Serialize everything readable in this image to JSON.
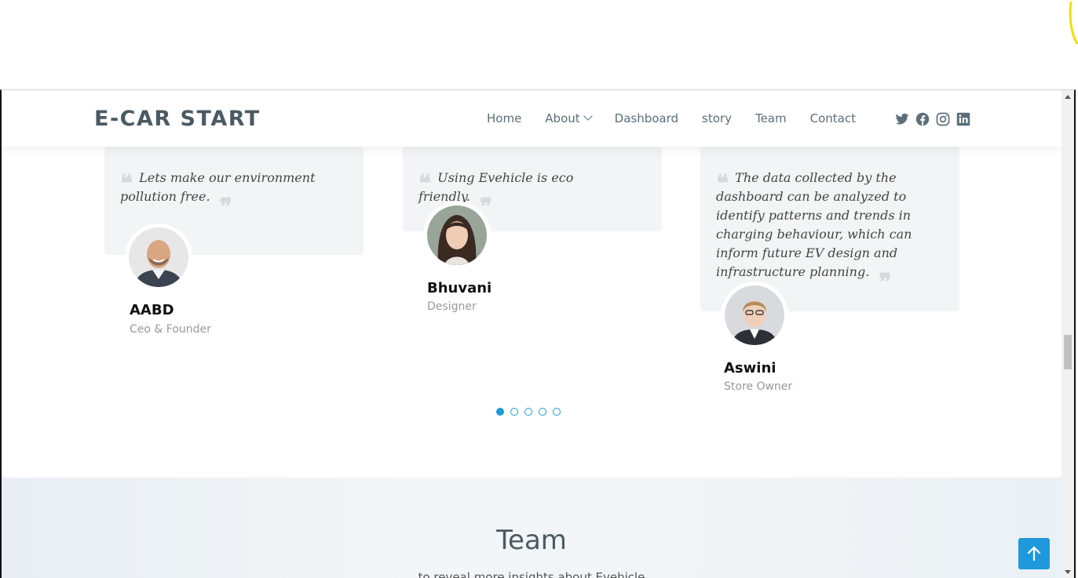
{
  "header": {
    "logo": "E-CAR START",
    "nav": [
      {
        "label": "Home",
        "name": "nav-home"
      },
      {
        "label": "About",
        "name": "nav-about",
        "dropdown": true
      },
      {
        "label": "Dashboard",
        "name": "nav-dashboard"
      },
      {
        "label": "story",
        "name": "nav-story"
      },
      {
        "label": "Team",
        "name": "nav-team"
      },
      {
        "label": "Contact",
        "name": "nav-contact"
      }
    ],
    "social_icons": [
      "twitter-icon",
      "facebook-icon",
      "instagram-icon",
      "linkedin-icon"
    ]
  },
  "testimonials": [
    {
      "quote": "Lets make our environment pollution free.",
      "name": "AABD",
      "role": "Ceo & Founder"
    },
    {
      "quote": "Using Evehicle is eco friendly.",
      "name": "Bhuvani",
      "role": "Designer"
    },
    {
      "quote": "The data collected by the dashboard can be analyzed to identify patterns and trends in charging behaviour, which can inform future EV design and infrastructure planning.",
      "name": "Aswini",
      "role": "Store Owner"
    }
  ],
  "pagination": {
    "count": 5,
    "active": 0
  },
  "team": {
    "title": "Team",
    "subtitle": "to reveal more insights about Evehicle"
  },
  "colors": {
    "accent": "#1e9adc",
    "logo": "#4b5a62",
    "nav": "#5b6f7a",
    "quote_bg": "#f3f4f5"
  },
  "icons": {
    "scroll_top": "arrow-up-icon"
  }
}
